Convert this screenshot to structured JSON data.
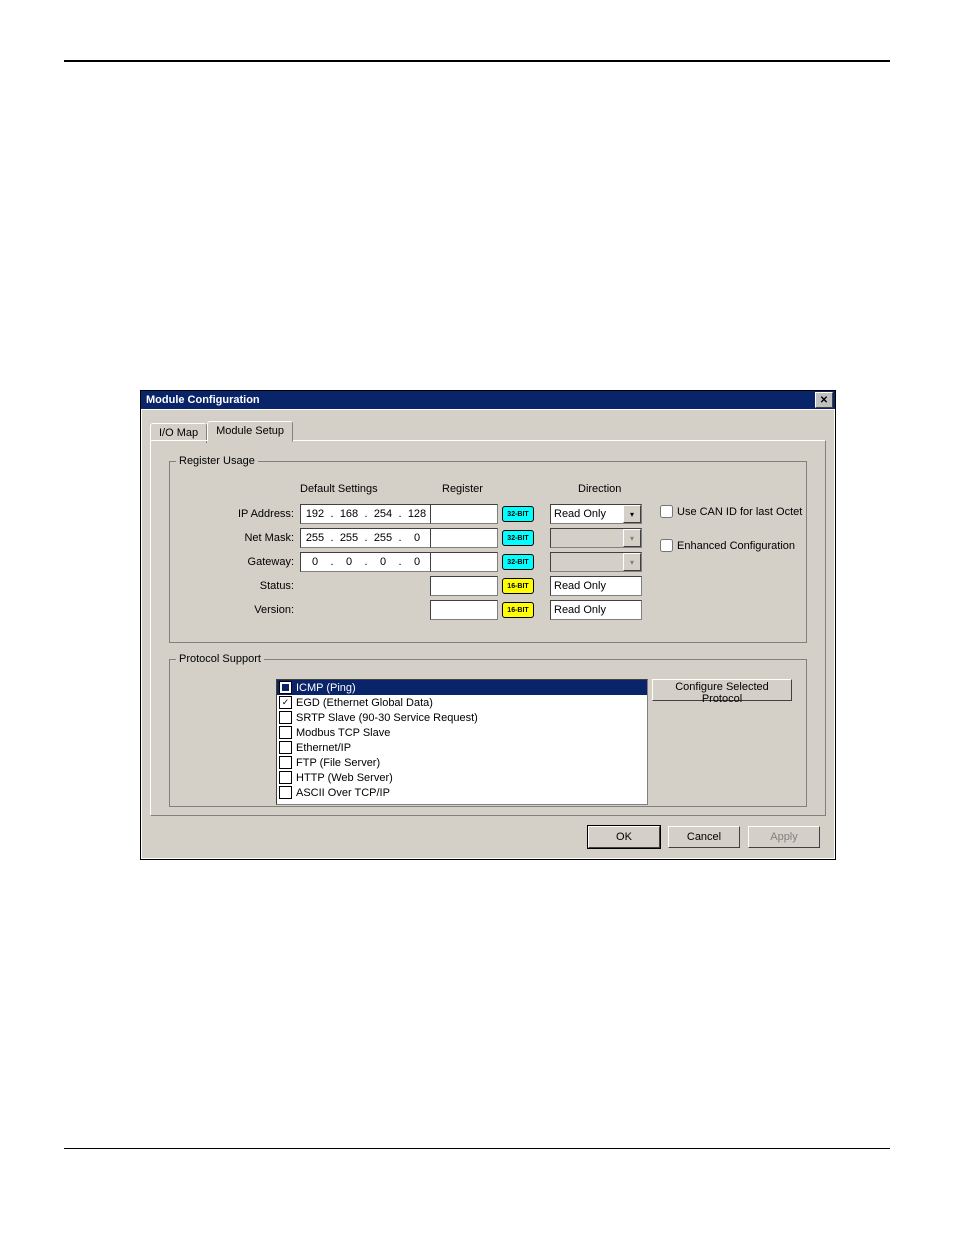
{
  "window": {
    "title": "Module Configuration"
  },
  "tabs": [
    "I/O Map",
    "Module Setup"
  ],
  "register": {
    "legend": "Register Usage",
    "headers": {
      "default": "Default Settings",
      "register": "Register",
      "direction": "Direction"
    },
    "pill32": "32-BIT",
    "pill16": "16-BIT",
    "rows": [
      {
        "label": "IP Address:",
        "ip": [
          "192",
          "168",
          "254",
          "128"
        ],
        "direction": "Read Only"
      },
      {
        "label": "Net Mask:",
        "ip": [
          "255",
          "255",
          "255",
          "0"
        ],
        "direction": ""
      },
      {
        "label": "Gateway:",
        "ip": [
          "0",
          "0",
          "0",
          "0"
        ],
        "direction": ""
      },
      {
        "label": "Status:",
        "direction": "Read Only"
      },
      {
        "label": "Version:",
        "direction": "Read Only"
      }
    ],
    "checkboxes": [
      "Use CAN ID for last Octet",
      "Enhanced Configuration"
    ]
  },
  "protocol": {
    "legend": "Protocol Support",
    "configure_btn": "Configure Selected Protocol",
    "items": [
      {
        "label": "ICMP (Ping)",
        "selected": true,
        "state": "partial"
      },
      {
        "label": "EGD (Ethernet Global Data)",
        "state": "checked"
      },
      {
        "label": "SRTP Slave (90-30 Service Request)",
        "state": "unchecked"
      },
      {
        "label": "Modbus TCP Slave",
        "state": "unchecked"
      },
      {
        "label": "Ethernet/IP",
        "state": "unchecked"
      },
      {
        "label": "FTP (File Server)",
        "state": "unchecked"
      },
      {
        "label": "HTTP (Web Server)",
        "state": "unchecked"
      },
      {
        "label": "ASCII Over TCP/IP",
        "state": "unchecked"
      }
    ]
  },
  "buttons": {
    "ok": "OK",
    "cancel": "Cancel",
    "apply": "Apply"
  }
}
